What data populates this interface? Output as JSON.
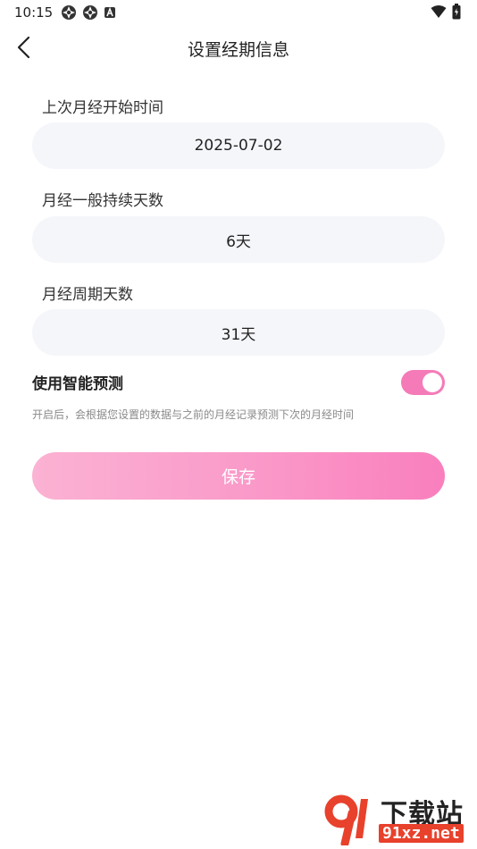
{
  "status_bar": {
    "time": "10:15",
    "left_icons": [
      "settings-icon",
      "settings-icon",
      "notification-a-icon"
    ],
    "right_icons": [
      "wifi-icon",
      "battery-icon"
    ]
  },
  "header": {
    "back_icon": "chevron-left-icon",
    "title": "设置经期信息"
  },
  "form": {
    "last_start": {
      "label": "上次月经开始时间",
      "value": "2025-07-02"
    },
    "duration": {
      "label": "月经一般持续天数",
      "value": "6天"
    },
    "cycle": {
      "label": "月经周期天数",
      "value": "31天"
    }
  },
  "prediction": {
    "title": "使用智能预测",
    "enabled": true,
    "description": "开启后，会根据您设置的数据与之前的月经记录预测下次的月经时间"
  },
  "save_label": "保存",
  "watermark": {
    "top": "下载站",
    "bottom": "91xz.net"
  },
  "colors": {
    "accent": "#f47bb8",
    "field_bg": "#f5f6fa",
    "button_gradient_start": "#fbb2d3",
    "button_gradient_end": "#f97fbd"
  }
}
